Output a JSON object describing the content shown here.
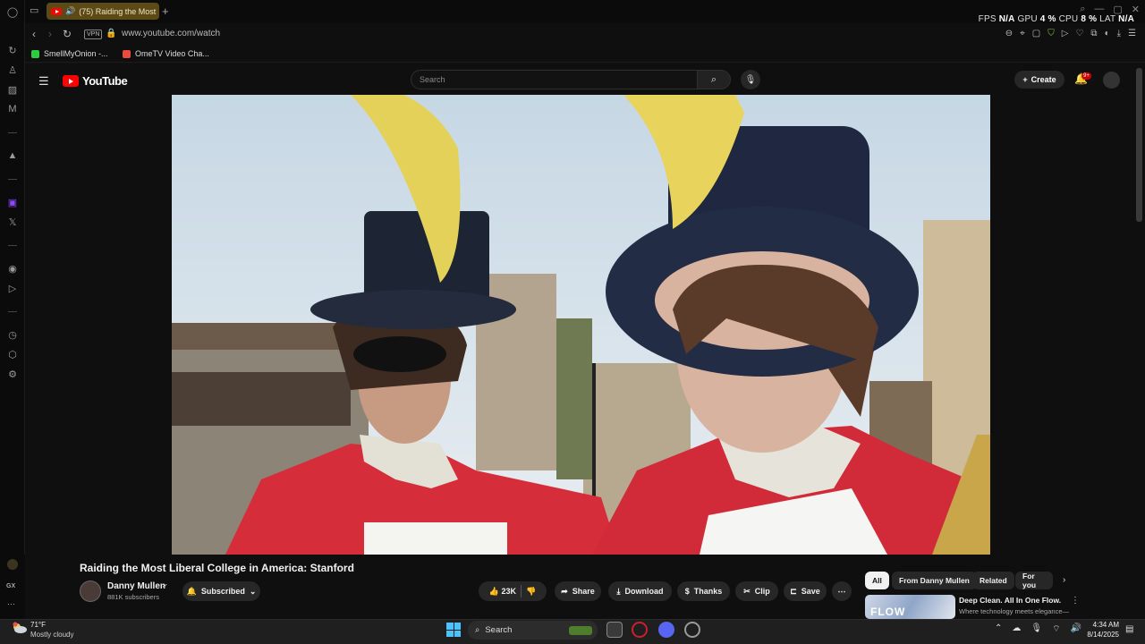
{
  "browser": {
    "tab_title": "(75) Raiding the Most",
    "url": "www.youtube.com/watch",
    "vpn_label": "VPN",
    "bookmarks": [
      {
        "label": "SmellMyOnion -...",
        "color": "#2ecc40"
      },
      {
        "label": "OmeTV Video Cha...",
        "color": "#e74c3c"
      }
    ],
    "stats": {
      "fps_label": "FPS",
      "fps_value": "N/A",
      "gpu_label": "GPU",
      "gpu_value": "4 %",
      "cpu_label": "CPU",
      "cpu_value": "8 %",
      "lat_label": "LAT",
      "lat_value": "N/A"
    }
  },
  "youtube": {
    "logo_text": "YouTube",
    "search_placeholder": "Search",
    "create_label": "Create",
    "notification_badge": "9+"
  },
  "video": {
    "title": "Raiding the Most Liberal College in America: Stanford",
    "channel_name": "Danny Mullen",
    "subscribers": "881K subscribers",
    "subscribed_label": "Subscribed",
    "likes": "23K",
    "share_label": "Share",
    "download_label": "Download",
    "thanks_label": "Thanks",
    "clip_label": "Clip",
    "save_label": "Save"
  },
  "recommendations": {
    "chips": [
      "All",
      "From Danny Mullen",
      "Related",
      "For you"
    ],
    "items": [
      {
        "title": "Deep Clean. All In One Flow.",
        "desc": "Where technology meets elegance—",
        "thumb_text": "FLOW"
      }
    ]
  },
  "taskbar": {
    "temperature": "71°F",
    "condition": "Mostly cloudy",
    "search_label": "Search",
    "time": "4:34 AM",
    "date": "8/14/2025"
  },
  "gx_label": "GX",
  "colors": {
    "accent": "#ff0000",
    "tab_bg": "#5b4a16",
    "taskbar_accent": "#4cc2ff"
  }
}
